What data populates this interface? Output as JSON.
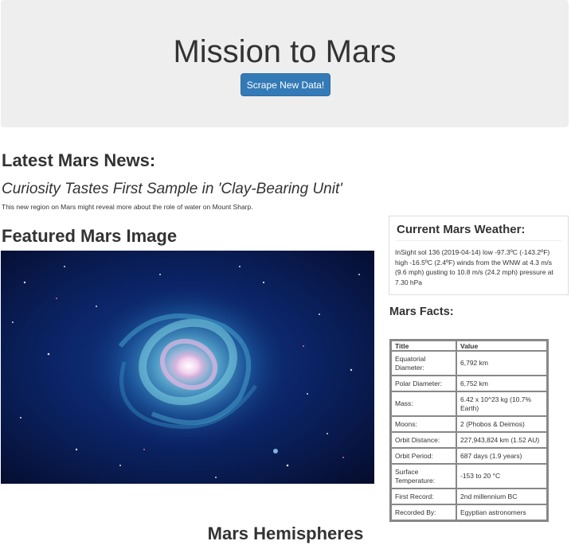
{
  "header": {
    "title": "Mission to Mars",
    "scrape_button_label": "Scrape New Data!"
  },
  "news": {
    "heading": "Latest Mars News:",
    "title": "Curiosity Tastes First Sample in 'Clay-Bearing Unit'",
    "paragraph": "This new region on Mars might reveal more about the role of water on Mount Sharp."
  },
  "featured_image": {
    "heading": "Featured Mars Image",
    "subject": "spiral-galaxy-space-photo"
  },
  "weather": {
    "heading": "Current Mars Weather:",
    "text": "InSight sol 136 (2019-04-14) low -97.3ºC (-143.2ºF) high -16.5ºC (2.4ºF) winds from the WNW at 4.3 m/s (9.6 mph) gusting to 10.8 m/s (24.2 mph) pressure at 7.30 hPa"
  },
  "facts": {
    "heading": "Mars Facts:",
    "columns": [
      "Title",
      "Value"
    ],
    "rows": [
      {
        "title": "Equatorial Diameter:",
        "value": "6,792 km"
      },
      {
        "title": "Polar Diameter:",
        "value": "6,752 km"
      },
      {
        "title": "Mass:",
        "value": "6.42 x 10^23 kg (10.7% Earth)"
      },
      {
        "title": "Moons:",
        "value": "2 (Phobos & Deimos)"
      },
      {
        "title": "Orbit Distance:",
        "value": "227,943,824 km (1.52 AU)"
      },
      {
        "title": "Orbit Period:",
        "value": "687 days (1.9 years)"
      },
      {
        "title": "Surface Temperature:",
        "value": "-153 to 20 °C"
      },
      {
        "title": "First Record:",
        "value": "2nd millennium BC"
      },
      {
        "title": "Recorded By:",
        "value": "Egyptian astronomers"
      }
    ]
  },
  "hemispheres": {
    "heading": "Mars Hemispheres"
  },
  "colors": {
    "jumbotron_bg": "#eeeeee",
    "button_primary": "#337ab7",
    "table_border": "#888888"
  }
}
